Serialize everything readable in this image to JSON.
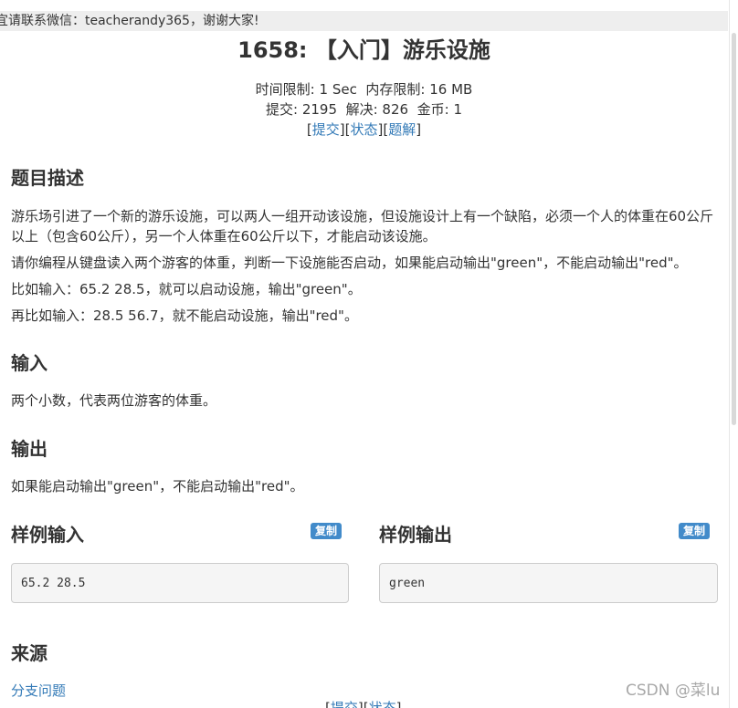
{
  "notice": "宜请联系微信：teacherandy365，谢谢大家!",
  "problem": {
    "title": "1658: 【入门】游乐设施",
    "time_limit_label": "时间限制:",
    "time_limit": "1 Sec",
    "memory_limit_label": "内存限制:",
    "memory_limit": "16 MB",
    "submit_label": "提交:",
    "submit_count": "2195",
    "solved_label": "解决:",
    "solved_count": "826",
    "coins_label": "金币:",
    "coins": "1",
    "links": {
      "submit": "提交",
      "status": "状态",
      "solution": "题解"
    }
  },
  "sections": {
    "description": {
      "heading": "题目描述",
      "paragraphs": [
        "游乐场引进了一个新的游乐设施，可以两人一组开动该设施，但设施设计上有一个缺陷，必须一个人的体重在60公斤以上（包含60公斤），另一个人体重在60公斤以下，才能启动该设施。",
        "请你编程从键盘读入两个游客的体重，判断一下设施能否启动，如果能启动输出\"green\"，不能启动输出\"red\"。",
        "比如输入：65.2 28.5，就可以启动设施，输出\"green\"。",
        "再比如输入：28.5 56.7，就不能启动设施，输出\"red\"。"
      ]
    },
    "input": {
      "heading": "输入",
      "text": "两个小数，代表两位游客的体重。"
    },
    "output": {
      "heading": "输出",
      "text": "如果能启动输出\"green\"，不能启动输出\"red\"。"
    },
    "sample_input": {
      "heading": "样例输入",
      "copy_label": "复制",
      "value": "65.2 28.5"
    },
    "sample_output": {
      "heading": "样例输出",
      "copy_label": "复制",
      "value": "green"
    },
    "source": {
      "heading": "来源",
      "link": "分支问题"
    }
  },
  "footer": {
    "submit": "提交",
    "status": "状态"
  },
  "watermark": "CSDN @菜lu"
}
